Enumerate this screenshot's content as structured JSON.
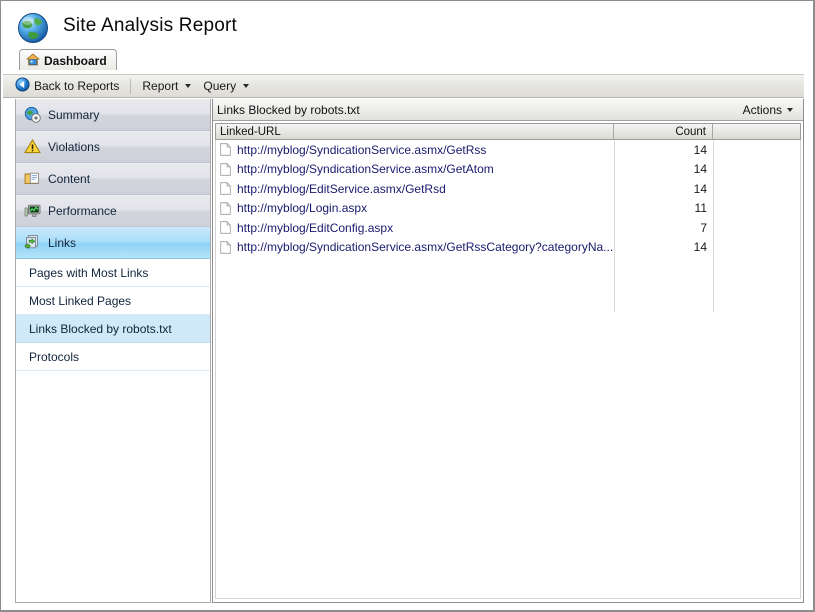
{
  "window": {
    "title": "Site Analysis Report",
    "logo_icon": "globe-icon",
    "menu_chevron_icon": "chevron-down-icon"
  },
  "tabs": [
    {
      "label": "Dashboard",
      "icon": "home-icon",
      "selected": true
    }
  ],
  "toolbar": {
    "back_label": "Back to Reports",
    "back_icon": "back-arrow-icon",
    "menus": [
      {
        "label": "Report",
        "icon": "chevron-down-icon"
      },
      {
        "label": "Query",
        "icon": "chevron-down-icon"
      }
    ]
  },
  "sidebar": {
    "categories": [
      {
        "label": "Summary",
        "icon": "globe-icon",
        "selected": false
      },
      {
        "label": "Violations",
        "icon": "warning-icon",
        "selected": false
      },
      {
        "label": "Content",
        "icon": "content-icon",
        "selected": false
      },
      {
        "label": "Performance",
        "icon": "performance-icon",
        "selected": false
      },
      {
        "label": "Links",
        "icon": "links-icon",
        "selected": true
      }
    ],
    "subitems": [
      {
        "label": "Pages with Most Links",
        "selected": false
      },
      {
        "label": "Most Linked Pages",
        "selected": false
      },
      {
        "label": "Links Blocked by robots.txt",
        "selected": true
      },
      {
        "label": "Protocols",
        "selected": false
      }
    ]
  },
  "content": {
    "header_title": "Links Blocked by robots.txt",
    "actions_label": "Actions",
    "actions_icon": "chevron-down-icon"
  },
  "grid": {
    "columns": [
      {
        "label": "Linked-URL",
        "align": "left"
      },
      {
        "label": "Count",
        "align": "right"
      },
      {
        "label": "",
        "align": "left"
      }
    ],
    "rows": [
      {
        "icon": "page-icon",
        "url": "http://myblog/SyndicationService.asmx/GetRss",
        "count": "14"
      },
      {
        "icon": "page-icon",
        "url": "http://myblog/SyndicationService.asmx/GetAtom",
        "count": "14"
      },
      {
        "icon": "page-icon",
        "url": "http://myblog/EditService.asmx/GetRsd",
        "count": "14"
      },
      {
        "icon": "page-icon",
        "url": "http://myblog/Login.aspx",
        "count": "11"
      },
      {
        "icon": "page-icon",
        "url": "http://myblog/EditConfig.aspx",
        "count": "7"
      },
      {
        "icon": "page-icon",
        "url": "http://myblog/SyndicationService.asmx/GetRssCategory?categoryNa...",
        "count": "14"
      }
    ]
  },
  "colors": {
    "selection_blue": "#8ed2f5",
    "subitem_selection": "#cfe9f9",
    "link_text": "#1a1a6e",
    "toolbar_bg": "#e6e5e0"
  }
}
